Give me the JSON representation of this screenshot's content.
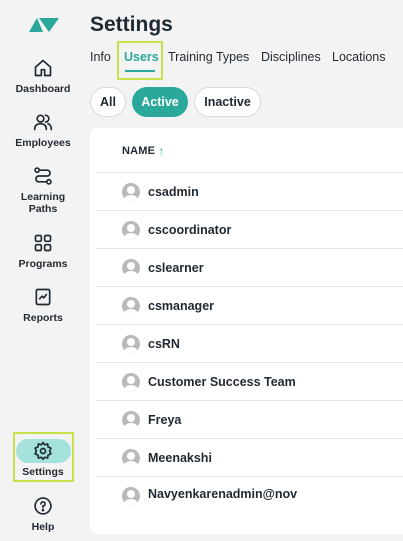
{
  "colors": {
    "accent": "#2ba89c",
    "highlight": "#c8e04a",
    "settings_pill": "#a6e2dc"
  },
  "sidebar": {
    "items": [
      {
        "label": "Dashboard",
        "icon": "home-icon"
      },
      {
        "label": "Employees",
        "icon": "people-icon"
      },
      {
        "label": "Learning Paths",
        "icon": "path-icon"
      },
      {
        "label": "Programs",
        "icon": "grid-icon"
      },
      {
        "label": "Reports",
        "icon": "report-icon"
      },
      {
        "label": "Settings",
        "icon": "gear-icon",
        "active": true
      },
      {
        "label": "Help",
        "icon": "help-icon"
      }
    ]
  },
  "header": {
    "title": "Settings"
  },
  "tabs": [
    {
      "label": "Info"
    },
    {
      "label": "Users",
      "active": true
    },
    {
      "label": "Training Types"
    },
    {
      "label": "Disciplines"
    },
    {
      "label": "Locations"
    }
  ],
  "filters": [
    {
      "label": "All"
    },
    {
      "label": "Active",
      "selected": true
    },
    {
      "label": "Inactive"
    }
  ],
  "table": {
    "column_header": "NAME",
    "sort": "ascending",
    "rows": [
      "csadmin",
      "cscoordinator",
      "cslearner",
      "csmanager",
      "csRN",
      "Customer Success Team",
      "Freya",
      "Meenakshi",
      "Navyenkarenadmin@nov"
    ]
  }
}
